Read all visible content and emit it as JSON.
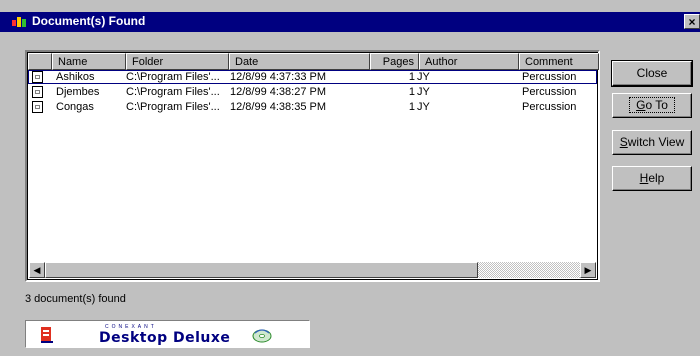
{
  "window": {
    "title": "Document(s) Found",
    "close_glyph": "×"
  },
  "list": {
    "columns": [
      "Name",
      "Folder",
      "Date",
      "Pages",
      "Author",
      "Comment"
    ],
    "rows": [
      {
        "name": "Ashikos",
        "folder": "C:\\Program Files'...",
        "date": "12/8/99 4:37:33 PM",
        "pages": "1",
        "author": "JY",
        "comment": "Percussion",
        "selected": true
      },
      {
        "name": "Djembes",
        "folder": "C:\\Program Files'...",
        "date": "12/8/99 4:38:27 PM",
        "pages": "1",
        "author": "JY",
        "comment": "Percussion",
        "selected": false
      },
      {
        "name": "Congas",
        "folder": "C:\\Program Files'...",
        "date": "12/8/99 4:38:35 PM",
        "pages": "1",
        "author": "JY",
        "comment": "Percussion",
        "selected": false
      }
    ],
    "scroll_left_glyph": "◀",
    "scroll_right_glyph": "▶"
  },
  "buttons": {
    "close": "Close",
    "goto_accel": "G",
    "goto_rest": "o To",
    "switch_accel": "S",
    "switch_rest": "witch View",
    "help_accel": "H",
    "help_rest": "elp"
  },
  "status": {
    "text": "3 document(s) found"
  },
  "banner": {
    "company": "CONEXANT",
    "product": "Desktop Deluxe"
  },
  "icons": {
    "title": "app-icon",
    "doc": "document-icon",
    "banner_logo": "conexant-logo-icon",
    "banner_disc": "disc-icon"
  },
  "colors": {
    "titlebar": "#000080",
    "face": "#c0c0c0",
    "brand": "#000080",
    "logo_red": "#e03020"
  }
}
